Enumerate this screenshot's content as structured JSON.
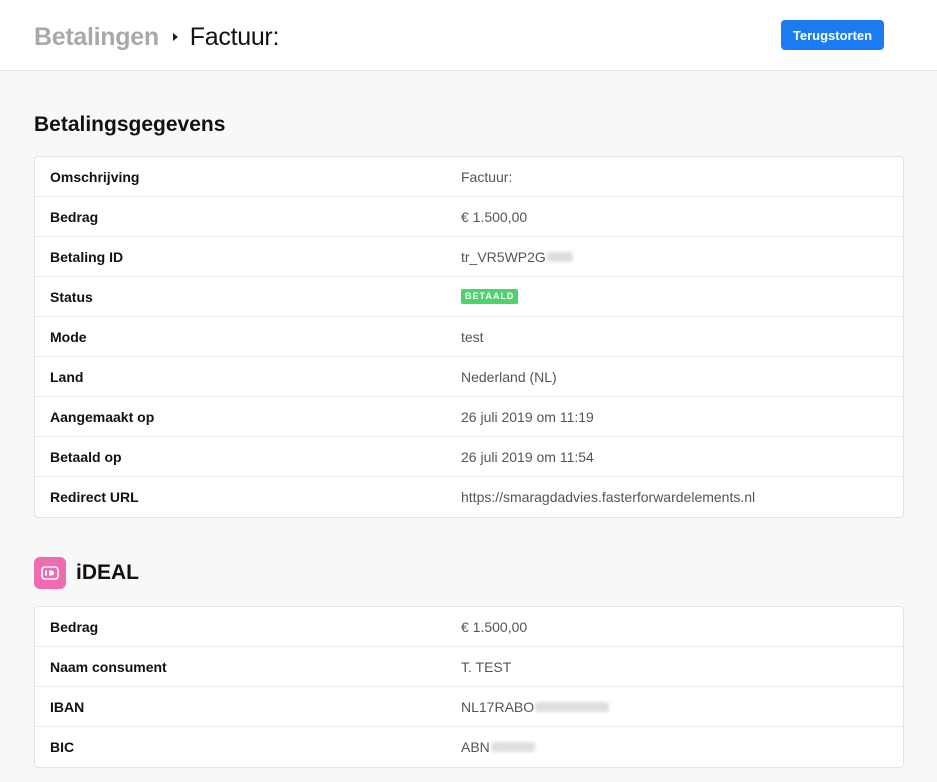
{
  "header": {
    "breadcrumb_parent": "Betalingen",
    "breadcrumb_current": "Factuur:",
    "refund_label": "Terugstorten"
  },
  "colors": {
    "accent": "#1a7bf2",
    "status_paid": "#4fd16e",
    "ideal_brand": "#f06bb0"
  },
  "payment": {
    "title": "Betalingsgegevens",
    "rows": [
      {
        "label": "Omschrijving",
        "value": "Factuur:"
      },
      {
        "label": "Bedrag",
        "value": "€ 1.500,00"
      },
      {
        "label": "Betaling ID",
        "value": "tr_VR5WP2G"
      },
      {
        "label": "Status",
        "value": "BETAALD"
      },
      {
        "label": "Mode",
        "value": "test"
      },
      {
        "label": "Land",
        "value": "Nederland (NL)"
      },
      {
        "label": "Aangemaakt op",
        "value": "26 juli 2019 om 11:19"
      },
      {
        "label": "Betaald op",
        "value": "26 juli 2019 om 11:54"
      },
      {
        "label": "Redirect URL",
        "value": "https://smaragdadvies.fasterforwardelements.nl"
      }
    ]
  },
  "ideal": {
    "icon": "ideal-logo-icon",
    "title": "iDEAL",
    "rows": [
      {
        "label": "Bedrag",
        "value": "€ 1.500,00"
      },
      {
        "label": "Naam consument",
        "value": "T. TEST"
      },
      {
        "label": "IBAN",
        "value": "NL17RABO"
      },
      {
        "label": "BIC",
        "value": "ABN"
      }
    ]
  }
}
